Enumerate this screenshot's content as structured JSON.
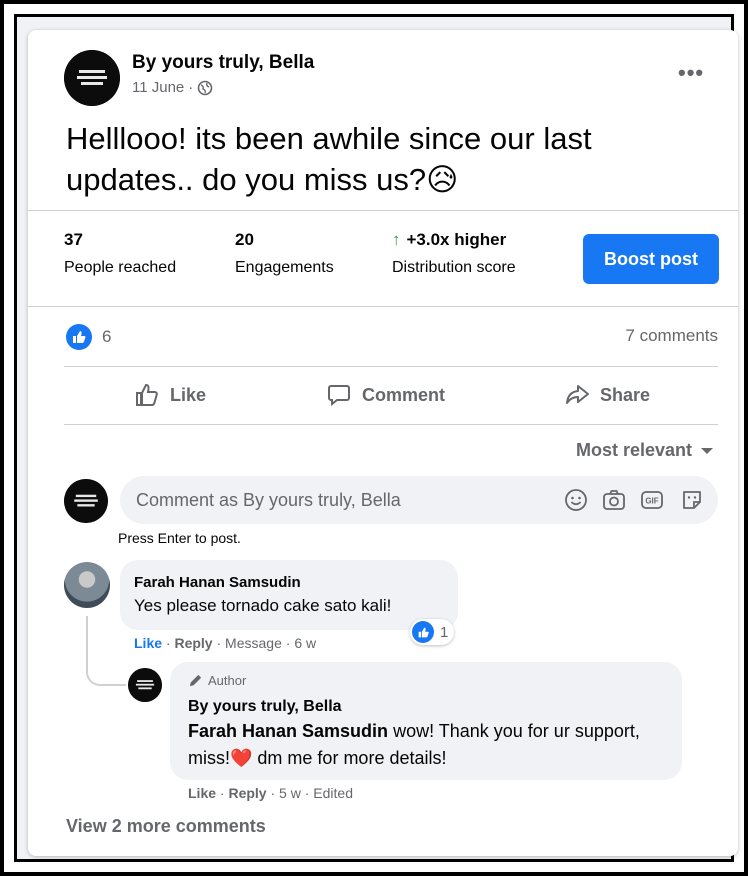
{
  "post": {
    "author": "By yours truly, Bella",
    "date": "11 June",
    "audience_icon": "globe-icon",
    "text": "Helllooo! its been awhile since our last updates.. do you miss us?😥"
  },
  "insights": {
    "reached_value": "37",
    "reached_label": "People reached",
    "engagements_value": "20",
    "engagements_label": "Engagements",
    "distribution_value": "+3.0x higher",
    "distribution_label": "Distribution score",
    "boost_label": "Boost post"
  },
  "reactions": {
    "count": "6",
    "comments": "7 comments"
  },
  "actions": {
    "like": "Like",
    "comment": "Comment",
    "share": "Share"
  },
  "sort_label": "Most relevant",
  "composer": {
    "placeholder": "Comment as By yours truly, Bella",
    "hint": "Press Enter to post."
  },
  "comments": [
    {
      "name": "Farah Hanan Samsudin",
      "text": "Yes please tornado cake sato kali!",
      "reaction_count": "1",
      "like": "Like",
      "reply": "Reply",
      "message": "Message",
      "time": "6 w"
    }
  ],
  "reply": {
    "badge": "Author",
    "name": "By yours truly, Bella",
    "mention": "Farah Hanan Samsudin",
    "text_before": " wow! Thank you for ur support, miss!",
    "emoji": "❤️",
    "text_after": " dm me for more details!",
    "like": "Like",
    "reply": "Reply",
    "time": "5 w",
    "edited": "Edited"
  },
  "view_more": "View 2 more comments",
  "colors": {
    "accent": "#1877f2",
    "secondary_text": "#65676b",
    "bubble": "#f0f2f5",
    "up_arrow": "#2e9e48"
  }
}
